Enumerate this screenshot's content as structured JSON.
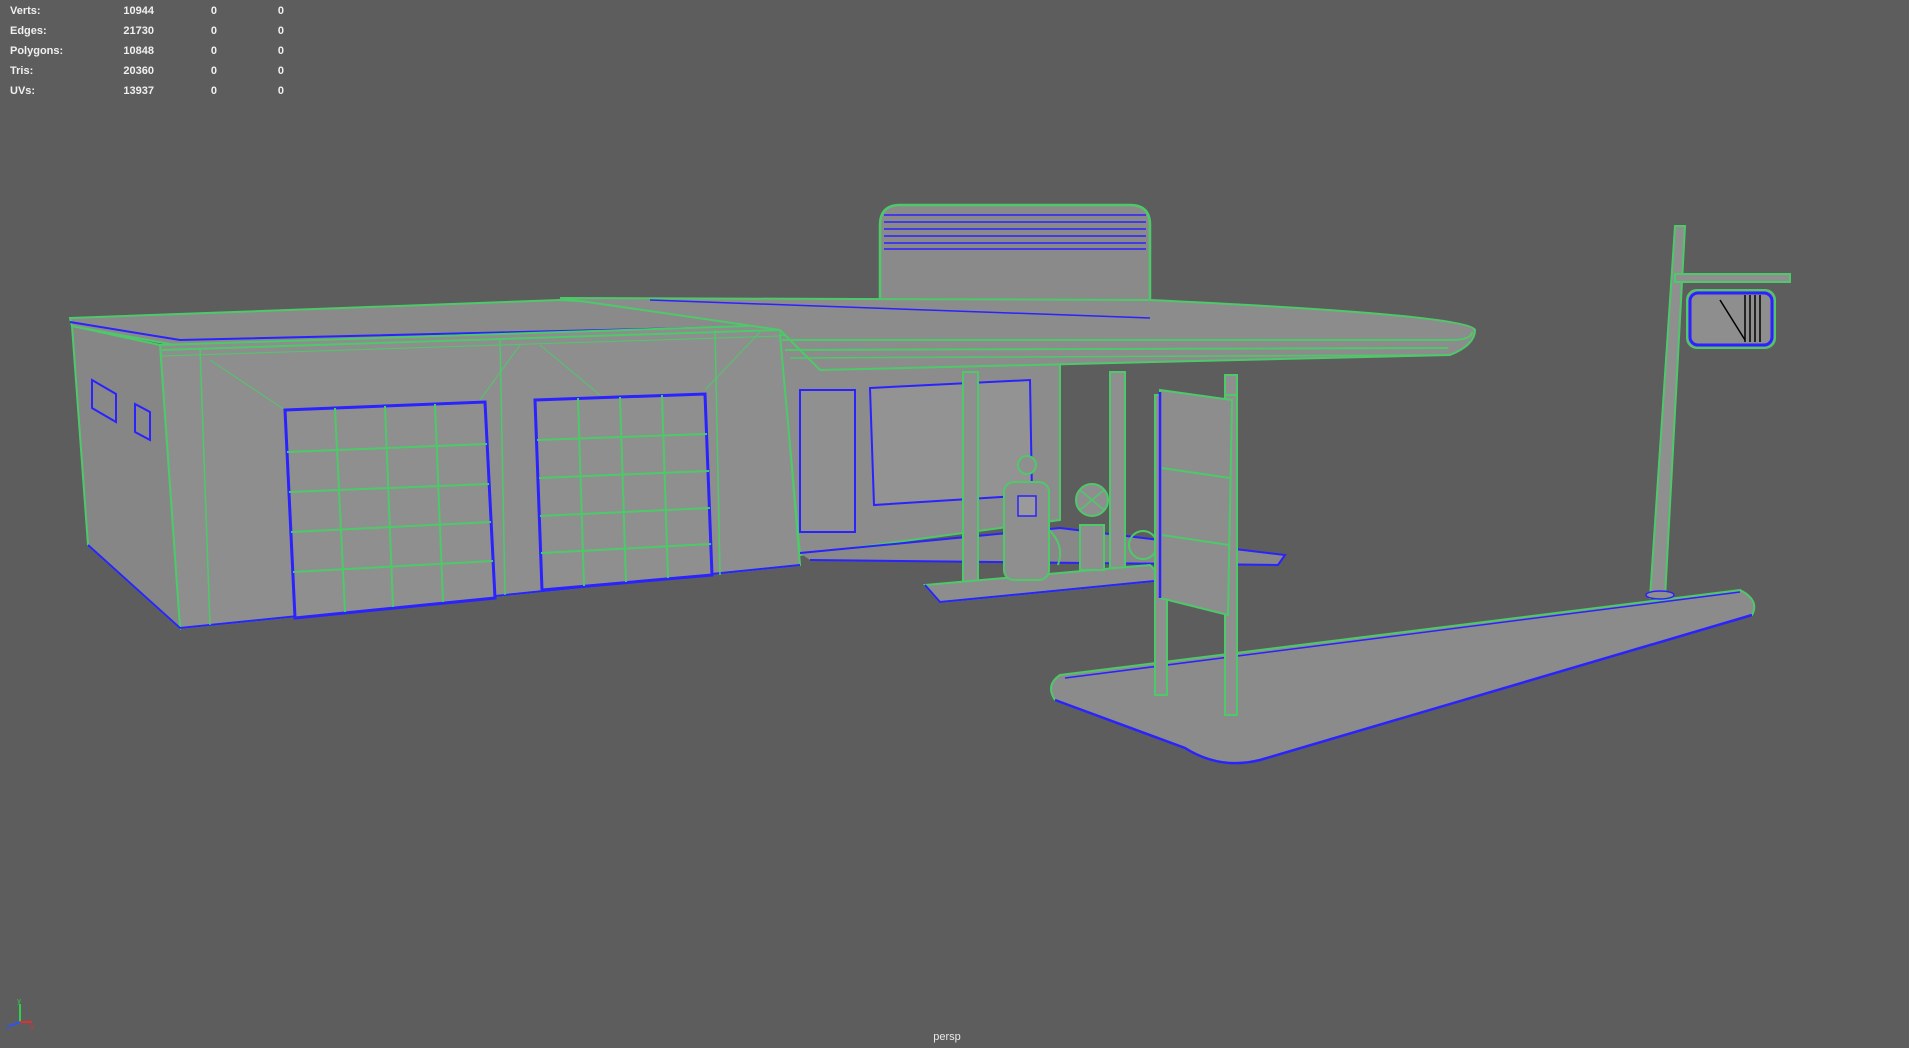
{
  "stats": {
    "rows": [
      {
        "label": "Verts:",
        "v1": "10944",
        "v2": "0",
        "v3": "0"
      },
      {
        "label": "Edges:",
        "v1": "21730",
        "v2": "0",
        "v3": "0"
      },
      {
        "label": "Polygons:",
        "v1": "10848",
        "v2": "0",
        "v3": "0"
      },
      {
        "label": "Tris:",
        "v1": "20360",
        "v2": "0",
        "v3": "0"
      },
      {
        "label": "UVs:",
        "v1": "13937",
        "v2": "0",
        "v3": "0"
      }
    ]
  },
  "viewport": {
    "camera": "persp",
    "background": "#5d5d5d",
    "wire_green": "#4ec96a",
    "wire_blue": "#2a22ff",
    "surface_gray": "#8e8e8e"
  },
  "axis": {
    "x": "red",
    "y": "green",
    "z": "blue"
  }
}
